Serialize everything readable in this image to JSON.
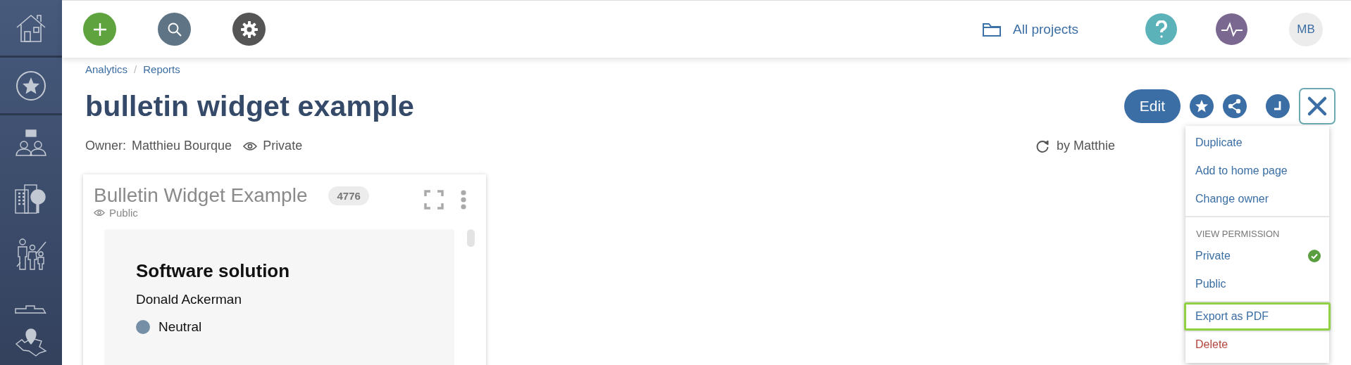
{
  "topbar": {
    "projects_link": "All projects",
    "avatar": "MB"
  },
  "page": {
    "breadcrumb": {
      "items": [
        "Analytics",
        "Reports"
      ],
      "separator": "/"
    },
    "title": "bulletin widget example",
    "owner_label": "Owner:",
    "owner": "Matthieu Bourque",
    "visibility": "Private",
    "edit_label": "Edit",
    "refreshed_by": "by Matthie"
  },
  "widget": {
    "title": "Bulletin Widget Example",
    "visibility": "Public",
    "count": "4776",
    "bulletin": {
      "title": "Software solution",
      "person": "Donald Ackerman",
      "sentiment": "Neutral"
    }
  },
  "menu": {
    "sections": [
      {
        "items": [
          {
            "label": "Duplicate",
            "kind": "action",
            "highlighted": false
          },
          {
            "label": "Add to home page",
            "kind": "action",
            "highlighted": false
          },
          {
            "label": "Change owner",
            "kind": "action",
            "highlighted": false
          }
        ]
      },
      {
        "header": "VIEW PERMISSION",
        "options": [
          {
            "label": "Private",
            "selected": true
          },
          {
            "label": "Public",
            "selected": false
          }
        ]
      },
      {
        "items": [
          {
            "label": "Export as PDF",
            "kind": "action",
            "highlighted": true
          },
          {
            "label": "Delete",
            "kind": "danger",
            "highlighted": false
          }
        ]
      }
    ]
  }
}
